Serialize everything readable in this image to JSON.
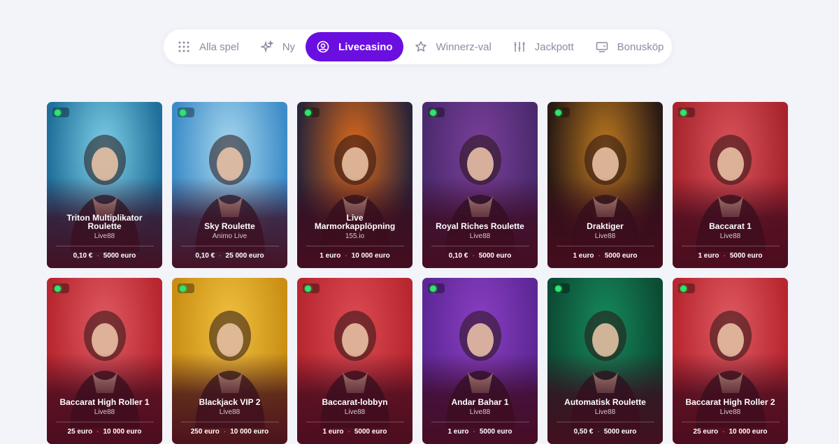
{
  "nav": {
    "tabs": [
      {
        "label": "Alla spel",
        "icon": "grid-icon",
        "active": false
      },
      {
        "label": "Ny",
        "icon": "sparkle-icon",
        "active": false
      },
      {
        "label": "Livecasino",
        "icon": "user-circle-icon",
        "active": true
      },
      {
        "label": "Winnerz-val",
        "icon": "star-icon",
        "active": false
      },
      {
        "label": "Jackpott",
        "icon": "sliders-icon",
        "active": false
      },
      {
        "label": "Bonusköp",
        "icon": "card-icon",
        "active": false
      }
    ],
    "accent": "#6a0fe0"
  },
  "games": [
    {
      "title": "Triton Multiplikator Roulette",
      "provider": "Live88",
      "min": "0,10 €",
      "max": "5000 euro",
      "bg": "#1f6f9a",
      "bg2": "#7fd0e8"
    },
    {
      "title": "Sky Roulette",
      "provider": "Animo Live",
      "min": "0,10 €",
      "max": "25 000 euro",
      "bg": "#3d8cc8",
      "bg2": "#a8d8ef"
    },
    {
      "title": "Live Marmorkapplöpning",
      "provider": "155.io",
      "min": "1 euro",
      "max": "10 000 euro",
      "bg": "#2b2538",
      "bg2": "#e06a1a"
    },
    {
      "title": "Royal Riches Roulette",
      "provider": "Live88",
      "min": "0,10 €",
      "max": "5000 euro",
      "bg": "#4b2a6e",
      "bg2": "#7a3f9a"
    },
    {
      "title": "Draktiger",
      "provider": "Live88",
      "min": "1 euro",
      "max": "5000 euro",
      "bg": "#2a1a14",
      "bg2": "#c07a20"
    },
    {
      "title": "Baccarat 1",
      "provider": "Live88",
      "min": "1 euro",
      "max": "5000 euro",
      "bg": "#a8252d",
      "bg2": "#d9525a"
    },
    {
      "title": "Baccarat High Roller 1",
      "provider": "Live88",
      "min": "25 euro",
      "max": "10 000 euro",
      "bg": "#b8262f",
      "bg2": "#df5a62"
    },
    {
      "title": "Blackjack VIP 2",
      "provider": "Live88",
      "min": "250 euro",
      "max": "10 000 euro",
      "bg": "#c98f14",
      "bg2": "#f1c040"
    },
    {
      "title": "Baccarat-lobbyn",
      "provider": "Live88",
      "min": "1 euro",
      "max": "5000 euro",
      "bg": "#b8262f",
      "bg2": "#dc4a52"
    },
    {
      "title": "Andar Bahar 1",
      "provider": "Live88",
      "min": "1 euro",
      "max": "5000 euro",
      "bg": "#5d2796",
      "bg2": "#8a3fc2"
    },
    {
      "title": "Automatisk Roulette",
      "provider": "Live88",
      "min": "0,50 €",
      "max": "5000 euro",
      "bg": "#0c4b34",
      "bg2": "#168a5c"
    },
    {
      "title": "Baccarat High Roller 2",
      "provider": "Live88",
      "min": "25 euro",
      "max": "10 000 euro",
      "bg": "#b8262f",
      "bg2": "#df5a62"
    }
  ]
}
